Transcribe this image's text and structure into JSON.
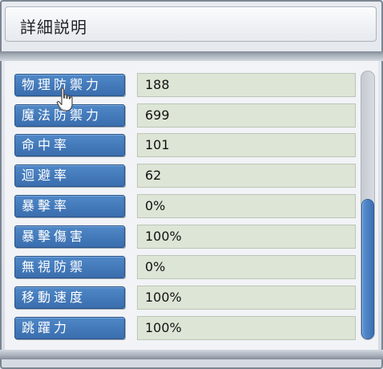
{
  "window": {
    "title": "詳細説明"
  },
  "stats": [
    {
      "label": "物理防禦力",
      "value": "188"
    },
    {
      "label": "魔法防禦力",
      "value": "699"
    },
    {
      "label": "命中率",
      "value": "101"
    },
    {
      "label": "迴避率",
      "value": "62"
    },
    {
      "label": "暴擊率",
      "value": "0%"
    },
    {
      "label": "暴擊傷害",
      "value": "100%"
    },
    {
      "label": "無視防禦",
      "value": "0%"
    },
    {
      "label": "移動速度",
      "value": "100%"
    },
    {
      "label": "跳躍力",
      "value": "100%"
    }
  ],
  "icons": {
    "cursor": "hand-pointer-icon"
  },
  "colors": {
    "label_button": "#4a82c2",
    "value_box": "#dde5d6",
    "scroll_thumb": "#4a82c2"
  }
}
